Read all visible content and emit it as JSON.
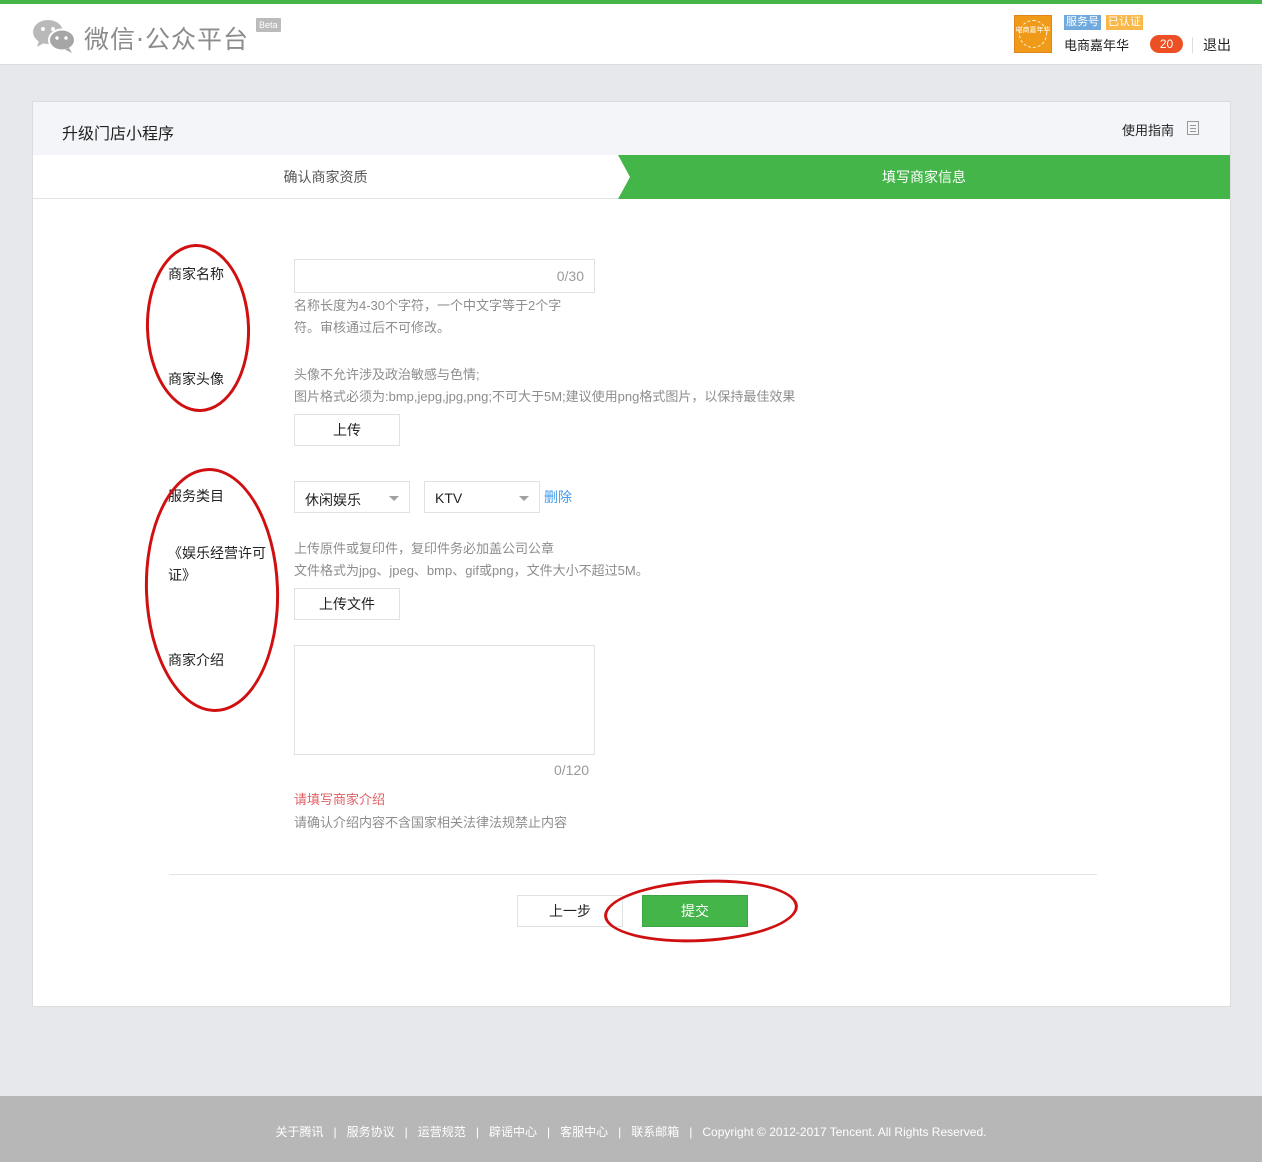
{
  "header": {
    "brand": "微信·公众平台",
    "beta": "Beta",
    "avatar_text": "电商嘉年华",
    "badge_service": "服务号",
    "badge_verified": "已认证",
    "account_name": "电商嘉年华",
    "notifications": "20",
    "logout": "退出"
  },
  "panel": {
    "title": "升级门店小程序",
    "guide": "使用指南",
    "steps": [
      "确认商家资质",
      "填写商家信息"
    ],
    "active_step": 1
  },
  "form": {
    "name_label": "商家名称",
    "name_counter": "0/30",
    "name_hint_1": "名称长度为4-30个字符，一个中文字等于2个字",
    "name_hint_2": "符。审核通过后不可修改。",
    "avatar_label": "商家头像",
    "avatar_hint_1": "头像不允许涉及政治敏感与色情;",
    "avatar_hint_2": "图片格式必须为:bmp,jepg,jpg,png;不可大于5M;建议使用png格式图片，以保持最佳效果",
    "upload_button": "上传",
    "category_label": "服务类目",
    "category_1": "休闲娱乐",
    "category_2": "KTV",
    "delete_link": "删除",
    "license_label_1": "《娱乐经营许可",
    "license_label_2": "证》",
    "license_hint_1": "上传原件或复印件，复印件务必加盖公司公章",
    "license_hint_2": "文件格式为jpg、jpeg、bmp、gif或png，文件大小不超过5M。",
    "upload_file_button": "上传文件",
    "intro_label": "商家介绍",
    "intro_counter": "0/120",
    "intro_error": "请填写商家介绍",
    "intro_hint": "请确认介绍内容不含国家相关法律法规禁止内容"
  },
  "actions": {
    "prev": "上一步",
    "submit": "提交"
  },
  "footer": {
    "links": [
      "关于腾讯",
      "服务协议",
      "运营规范",
      "辟谣中心",
      "客服中心",
      "联系邮箱"
    ],
    "separator": "|",
    "copyright": "Copyright © 2012-2017 Tencent. All Rights Reserved."
  },
  "colors": {
    "brand_green": "#44b549",
    "annotation_red": "#d01010",
    "link_blue": "#459ae9",
    "error_red": "#e15f63"
  }
}
